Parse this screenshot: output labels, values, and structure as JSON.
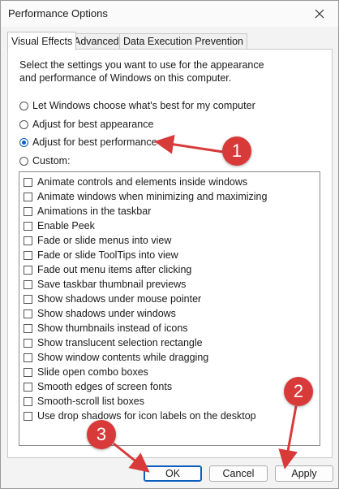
{
  "window": {
    "title": "Performance Options"
  },
  "tabs": [
    {
      "label": "Visual Effects",
      "active": true
    },
    {
      "label": "Advanced",
      "active": false
    },
    {
      "label": "Data Execution Prevention",
      "active": false
    }
  ],
  "description": "Select the settings you want to use for the appearance and performance of Windows on this computer.",
  "radios": [
    {
      "label": "Let Windows choose what's best for my computer",
      "checked": false
    },
    {
      "label": "Adjust for best appearance",
      "checked": false
    },
    {
      "label": "Adjust for best performance",
      "checked": true
    },
    {
      "label": "Custom:",
      "checked": false
    }
  ],
  "effects": [
    {
      "label": "Animate controls and elements inside windows",
      "checked": false
    },
    {
      "label": "Animate windows when minimizing and maximizing",
      "checked": false
    },
    {
      "label": "Animations in the taskbar",
      "checked": false
    },
    {
      "label": "Enable Peek",
      "checked": false
    },
    {
      "label": "Fade or slide menus into view",
      "checked": false
    },
    {
      "label": "Fade or slide ToolTips into view",
      "checked": false
    },
    {
      "label": "Fade out menu items after clicking",
      "checked": false
    },
    {
      "label": "Save taskbar thumbnail previews",
      "checked": false
    },
    {
      "label": "Show shadows under mouse pointer",
      "checked": false
    },
    {
      "label": "Show shadows under windows",
      "checked": false
    },
    {
      "label": "Show thumbnails instead of icons",
      "checked": false
    },
    {
      "label": "Show translucent selection rectangle",
      "checked": false
    },
    {
      "label": "Show window contents while dragging",
      "checked": false
    },
    {
      "label": "Slide open combo boxes",
      "checked": false
    },
    {
      "label": "Smooth edges of screen fonts",
      "checked": false
    },
    {
      "label": "Smooth-scroll list boxes",
      "checked": false
    },
    {
      "label": "Use drop shadows for icon labels on the desktop",
      "checked": false
    }
  ],
  "buttons": {
    "ok": "OK",
    "cancel": "Cancel",
    "apply": "Apply"
  },
  "annotations": {
    "step1": "1",
    "step2": "2",
    "step3": "3",
    "color": "#d83a3a"
  },
  "icons": {
    "close": "close-icon"
  }
}
